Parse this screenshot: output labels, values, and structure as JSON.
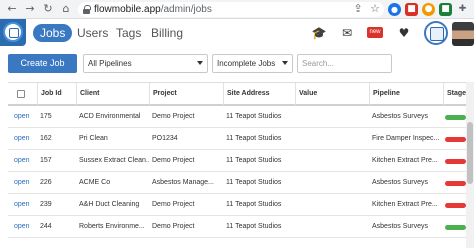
{
  "browser": {
    "url_host": "flowmobile.app",
    "url_path": "/admin/jobs"
  },
  "header": {
    "tabs": [
      {
        "label": "Jobs",
        "active": true
      },
      {
        "label": "Users",
        "active": false
      },
      {
        "label": "Tags",
        "active": false
      },
      {
        "label": "Billing",
        "active": false
      }
    ],
    "new_badge": "new"
  },
  "toolbar": {
    "create_label": "Create Job",
    "pipeline_filter": "All Pipelines",
    "status_filter": "Incomplete Jobs",
    "search_placeholder": "Search..."
  },
  "table": {
    "columns": [
      "Job Id",
      "Client",
      "Project",
      "Site Address",
      "Value",
      "Pipeline",
      "Stages"
    ],
    "rows": [
      {
        "action": "open",
        "job_id": "175",
        "client": "ACD Environmental",
        "project": "Demo Project",
        "site": "11 Teapot Studios",
        "value": "",
        "pipeline": "Asbestos Surveys",
        "stage_color": "#4caf50"
      },
      {
        "action": "open",
        "job_id": "162",
        "client": "Pri Clean",
        "project": "PO1234",
        "site": "11 Teapot Studios",
        "value": "",
        "pipeline": "Fire Damper Inspec...",
        "stage_color": "#e53935"
      },
      {
        "action": "open",
        "job_id": "157",
        "client": "Sussex Extract Clean...",
        "project": "Demo Project",
        "site": "11 Teapot Studios",
        "value": "",
        "pipeline": "Kitchen Extract Pre...",
        "stage_color": "#e53935"
      },
      {
        "action": "open",
        "job_id": "226",
        "client": "ACME Co",
        "project": "Asbestos Manage...",
        "site": "11 Teapot Studios",
        "value": "",
        "pipeline": "Asbestos Surveys",
        "stage_color": "#e53935"
      },
      {
        "action": "open",
        "job_id": "239",
        "client": "A&H Duct Cleaning",
        "project": "Demo Project",
        "site": "11 Teapot Studios",
        "value": "",
        "pipeline": "Kitchen Extract Pre...",
        "stage_color": "#e53935"
      },
      {
        "action": "open",
        "job_id": "244",
        "client": "Roberts Environme...",
        "project": "Demo Project",
        "site": "11 Teapot Studios",
        "value": "",
        "pipeline": "Asbestos Surveys",
        "stage_color": "#4caf50"
      }
    ]
  }
}
